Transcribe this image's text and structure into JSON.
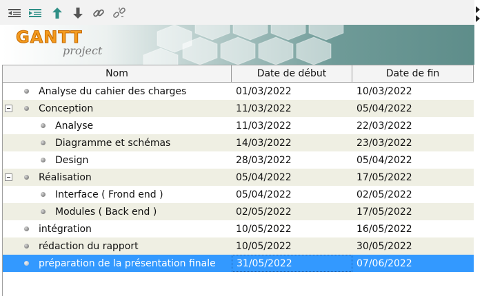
{
  "toolbar": {
    "buttons": [
      {
        "name": "unindent-icon"
      },
      {
        "name": "indent-icon"
      },
      {
        "name": "move-up-icon"
      },
      {
        "name": "move-down-icon"
      },
      {
        "name": "link-icon"
      },
      {
        "name": "unlink-icon"
      }
    ],
    "accent": "#2f8f86"
  },
  "banner": {
    "logo_main": "GANTT",
    "logo_sub": "project"
  },
  "table": {
    "columns": [
      "Nom",
      "Date de début",
      "Date de fin"
    ],
    "rows": [
      {
        "name": "Analyse du cahier des charges",
        "start": "01/03/2022",
        "end": "10/03/2022",
        "level": 0,
        "toggle": false
      },
      {
        "name": "Conception",
        "start": "11/03/2022",
        "end": "05/04/2022",
        "level": 0,
        "toggle": true
      },
      {
        "name": "Analyse",
        "start": "11/03/2022",
        "end": "22/03/2022",
        "level": 1,
        "toggle": false
      },
      {
        "name": "Diagramme et schémas",
        "start": "14/03/2022",
        "end": "23/03/2022",
        "level": 1,
        "toggle": false
      },
      {
        "name": "Design",
        "start": "28/03/2022",
        "end": "05/04/2022",
        "level": 1,
        "toggle": false
      },
      {
        "name": "Réalisation",
        "start": "05/04/2022",
        "end": "17/05/2022",
        "level": 0,
        "toggle": true
      },
      {
        "name": "Interface ( Frond end )",
        "start": "05/04/2022",
        "end": "02/05/2022",
        "level": 1,
        "toggle": false
      },
      {
        "name": "Modules ( Back end )",
        "start": "02/05/2022",
        "end": "17/05/2022",
        "level": 1,
        "toggle": false
      },
      {
        "name": "intégration",
        "start": "10/05/2022",
        "end": "16/05/2022",
        "level": 0,
        "toggle": false
      },
      {
        "name": "rédaction du rapport",
        "start": "10/05/2022",
        "end": "30/05/2022",
        "level": 0,
        "toggle": false
      },
      {
        "name": "préparation de la présentation finale",
        "start": "31/05/2022",
        "end": "07/06/2022",
        "level": 0,
        "toggle": false
      }
    ],
    "selected_index": 10,
    "colors": {
      "alt_row": "#efefe3",
      "selected": "#3399ff"
    }
  }
}
